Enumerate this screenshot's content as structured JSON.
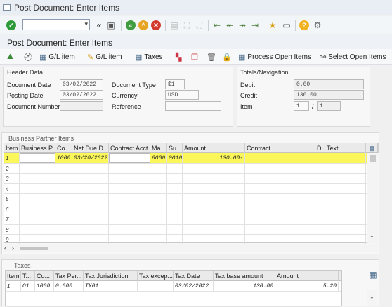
{
  "window": {
    "title": "Post Document: Enter Items"
  },
  "page": {
    "title": "Post Document: Enter Items"
  },
  "toolbar2": {
    "gl_item": "G/L item",
    "gl_item2": "G/L item",
    "taxes": "Taxes",
    "process_open_items": "Process Open Items",
    "select_open_items": "Select Open Items"
  },
  "header": {
    "title": "Header Data",
    "document_date_label": "Document Date",
    "document_date": "03/02/2022",
    "posting_date_label": "Posting Date",
    "posting_date": "03/02/2022",
    "document_number_label": "Document Number",
    "document_number": "",
    "document_type_label": "Document Type",
    "document_type": "$1",
    "currency_label": "Currency",
    "currency": "USD",
    "reference_label": "Reference",
    "reference": ""
  },
  "totals": {
    "title": "Totals/Navigation",
    "debit_label": "Debit",
    "debit": "0.00",
    "credit_label": "Credit",
    "credit": "130.00",
    "item_label": "Item",
    "item_current": "1",
    "item_sep": "/",
    "item_total": "1"
  },
  "bp_items": {
    "title": "Business Partner Items",
    "columns": [
      "Item",
      "Business P...",
      "Co...",
      "Net Due D...",
      "Contract Acct",
      "Ma...",
      "Su...",
      "Amount",
      "Contract",
      "D..",
      "Text"
    ],
    "row1": {
      "item": "1",
      "bp": "",
      "co": "1000",
      "due": "03/20/2022",
      "ca": "",
      "ma": "6000",
      "su": "0010",
      "amount": "130.00-",
      "contract": "",
      "d": "",
      "text": ""
    },
    "rows": [
      "2",
      "3",
      "4",
      "5",
      "6",
      "7",
      "8",
      "9"
    ]
  },
  "taxes": {
    "title": "Taxes",
    "columns": [
      "Item",
      "T...",
      "Co...",
      "Tax Per...",
      "Tax Jurisdiction",
      "Tax excep...",
      "Tax Date",
      "Tax base amount",
      "Amount"
    ],
    "row1": {
      "item": "1",
      "t": "O1",
      "co": "1000",
      "per": "0.000",
      "jur": "TX01",
      "exc": "",
      "date": "03/02/2022",
      "base": "130.00",
      "amount": "5.20"
    }
  }
}
